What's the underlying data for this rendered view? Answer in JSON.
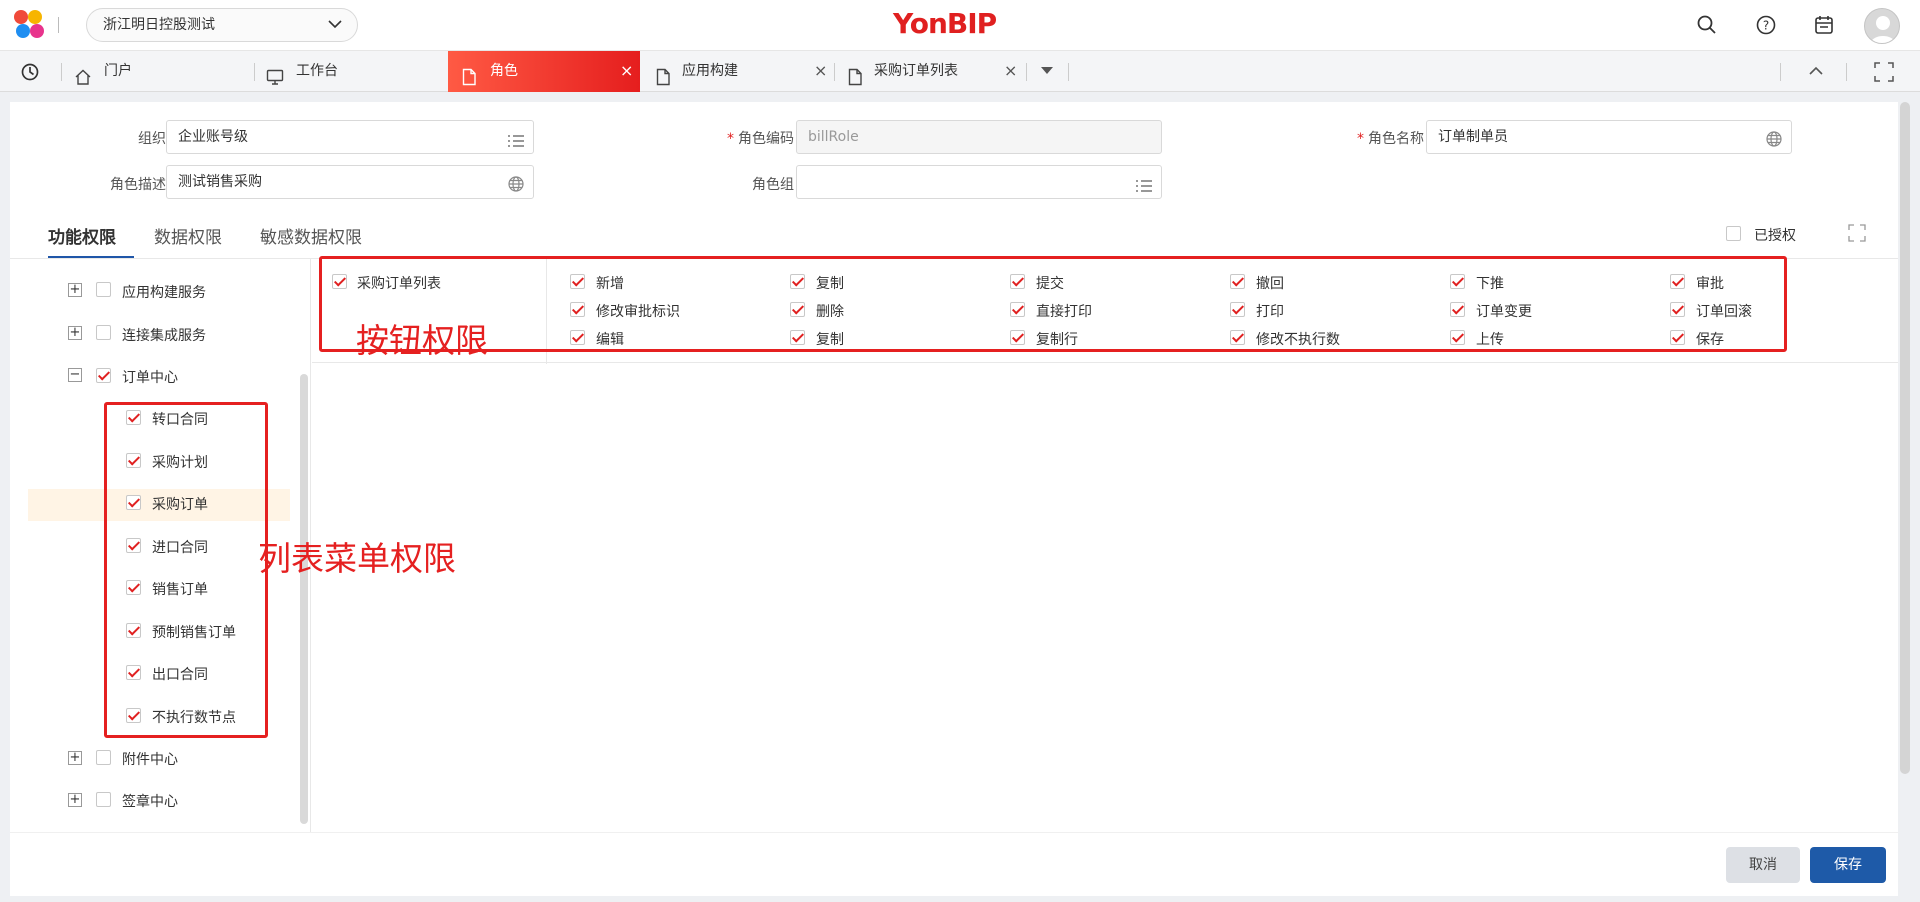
{
  "header": {
    "org_select": "浙江明日控股测试",
    "brand": "YonBIP"
  },
  "tabs": [
    {
      "label": "门户",
      "icon": "home-icon"
    },
    {
      "label": "工作台",
      "icon": "monitor-icon"
    },
    {
      "label": "角色",
      "icon": "document-icon",
      "active": true
    },
    {
      "label": "应用构建",
      "icon": "document-icon"
    },
    {
      "label": "采购订单列表",
      "icon": "document-icon"
    }
  ],
  "form": {
    "org": {
      "label": "组织",
      "value": "企业账号级"
    },
    "role_code": {
      "label": "角色编码",
      "value": "billRole",
      "required": true
    },
    "role_name": {
      "label": "角色名称",
      "value": "订单制单员",
      "required": true
    },
    "role_desc": {
      "label": "角色描述",
      "value": "测试销售采购"
    },
    "role_group": {
      "label": "角色组",
      "value": ""
    }
  },
  "perm_tabs": [
    "功能权限",
    "数据权限",
    "敏感数据权限"
  ],
  "authorized_label": "已授权",
  "tree": {
    "app_service": "应用构建服务",
    "connect_service": "连接集成服务",
    "order_center": "订单中心",
    "children": [
      "转口合同",
      "采购计划",
      "采购订单",
      "进口合同",
      "销售订单",
      "预制销售订单",
      "出口合同",
      "不执行数节点"
    ],
    "attach_center": "附件中心",
    "seal_center": "签章中心"
  },
  "button_perms": {
    "node": "采购订单列表",
    "rows": [
      [
        "新增",
        "复制",
        "提交",
        "撤回",
        "下推",
        "审批"
      ],
      [
        "修改审批标识",
        "删除",
        "直接打印",
        "打印",
        "订单变更",
        "订单回滚"
      ],
      [
        "编辑",
        "复制",
        "复制行",
        "修改不执行数",
        "上传",
        "保存"
      ]
    ]
  },
  "annotations": {
    "button": "按钮权限",
    "menu": "列表菜单权限"
  },
  "footer": {
    "cancel": "取消",
    "save": "保存"
  },
  "colors": {
    "accent_red": "#e02020",
    "primary_blue": "#1e5aa8",
    "annotation_red": "#e52020"
  }
}
